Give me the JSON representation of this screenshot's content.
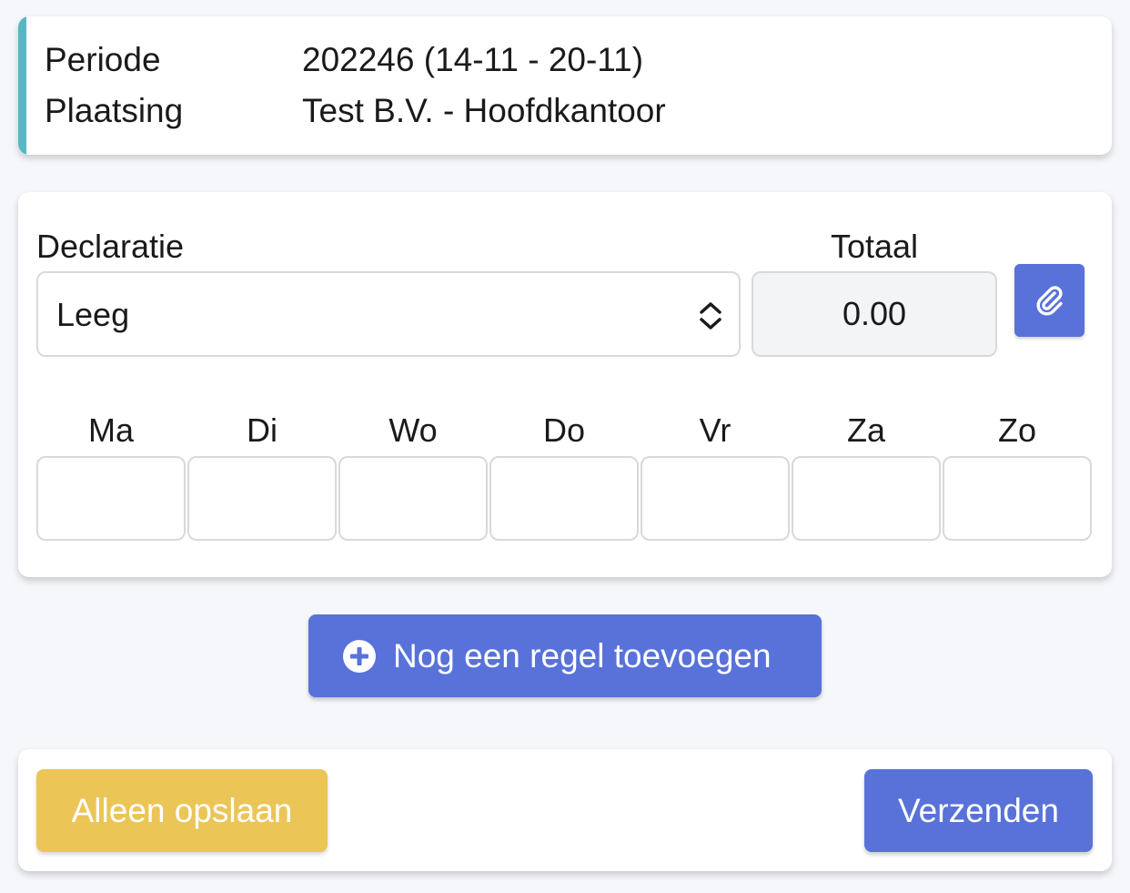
{
  "info": {
    "periode_label": "Periode",
    "periode_value": "202246 (14-11 - 20-11)",
    "plaatsing_label": "Plaatsing",
    "plaatsing_value": "Test B.V. - Hoofdkantoor",
    "accent_color": "#56b8c4"
  },
  "declaration": {
    "label": "Declaratie",
    "select_value": "Leeg",
    "total_label": "Totaal",
    "total_value": "0.00",
    "attach_icon": "paperclip-icon",
    "days": [
      {
        "label": "Ma",
        "value": ""
      },
      {
        "label": "Di",
        "value": ""
      },
      {
        "label": "Wo",
        "value": ""
      },
      {
        "label": "Do",
        "value": ""
      },
      {
        "label": "Vr",
        "value": ""
      },
      {
        "label": "Za",
        "value": ""
      },
      {
        "label": "Zo",
        "value": ""
      }
    ]
  },
  "actions": {
    "add_row_label": "Nog een regel toevoegen",
    "add_row_icon": "plus-circle-icon",
    "save_label": "Alleen opslaan",
    "send_label": "Verzenden"
  },
  "colors": {
    "primary": "#5872d9",
    "warning": "#ecc557",
    "background": "#f5f7fa"
  }
}
